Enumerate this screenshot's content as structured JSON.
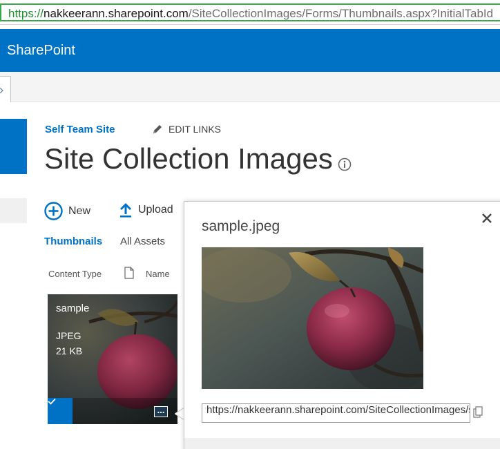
{
  "browser": {
    "address_scheme": "https://",
    "address_host": "nakkeerann.sharepoint.com",
    "address_path": "/SiteCollectionImages/Forms/Thumbnails.aspx?InitialTabId"
  },
  "suite": {
    "brand": "SharePoint"
  },
  "site": {
    "site_link": "Self Team Site",
    "edit_links": "EDIT LINKS",
    "page_title": "Site Collection Images"
  },
  "commands": {
    "new_label": "New",
    "upload_label": "Upload"
  },
  "views": {
    "thumbnails": "Thumbnails",
    "all_assets": "All Assets"
  },
  "columns": {
    "content_type": "Content Type",
    "name": "Name"
  },
  "tile": {
    "name": "sample",
    "type": "JPEG",
    "size": "21 KB"
  },
  "callout": {
    "title": "sample.jpeg",
    "url": "https://nakkeerann.sharepoint.com/SiteCollectionImages/sample.jpeg"
  },
  "colors": {
    "brand_blue": "#0072c6",
    "address_green": "#39a849",
    "apple_red": "#9b2d4a"
  },
  "icons": {
    "new": "plus-circle-icon",
    "upload": "upload-arrow-icon",
    "edit": "pencil-icon",
    "info": "info-icon",
    "doc": "document-icon",
    "close": "close-icon",
    "check": "checkmark-icon",
    "more": "ellipsis-icon",
    "copy": "copy-icon"
  }
}
